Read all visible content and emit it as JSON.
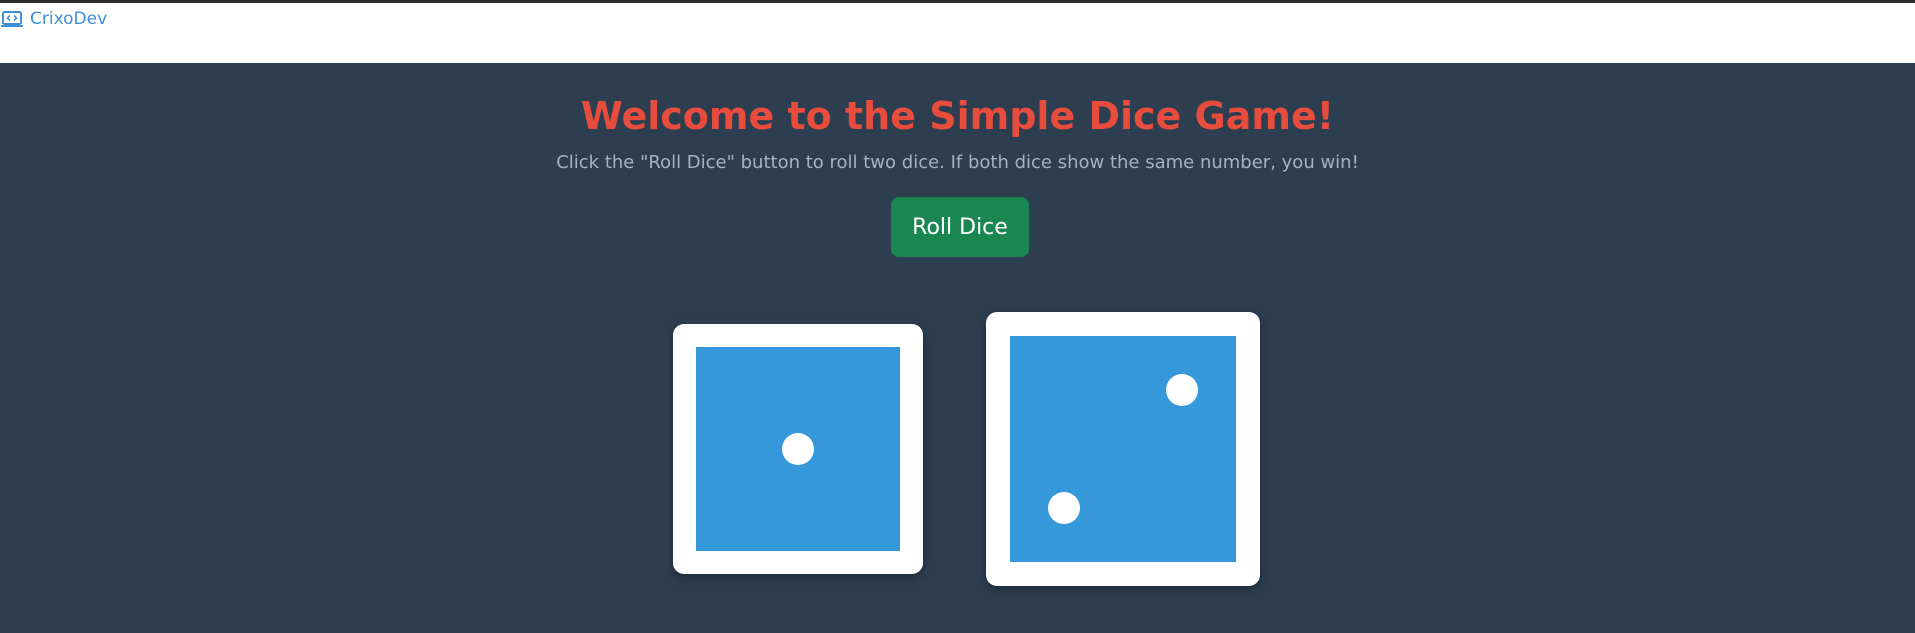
{
  "header": {
    "brand_name": "CrixoDev",
    "brand_icon": "code-laptop-icon",
    "brand_color": "#3f8fd6"
  },
  "game": {
    "title": "Welcome to the Simple Dice Game!",
    "instructions": "Click the \"Roll Dice\" button to roll two dice. If both dice show the same number, you win!",
    "roll_button_label": "Roll Dice",
    "dice_values": [
      1,
      2
    ]
  },
  "colors": {
    "background": "#2c3e50",
    "title": "#e74c3c",
    "button": "#1a8753",
    "die_face": "#3498db",
    "die_border": "#ffffff"
  }
}
